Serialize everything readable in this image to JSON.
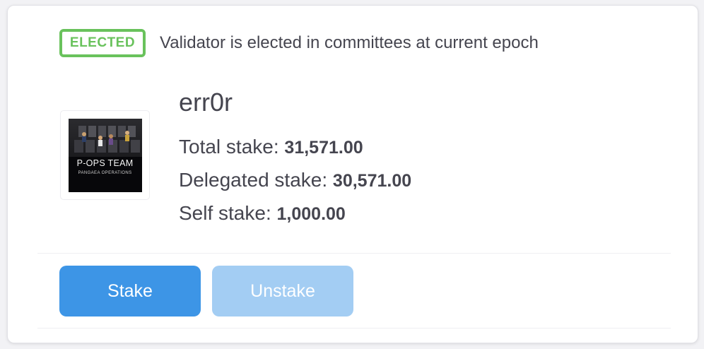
{
  "status": {
    "badge": "ELECTED",
    "description": "Validator is elected in committees at current epoch",
    "badge_color": "#69c25c"
  },
  "validator": {
    "name": "err0r",
    "logo": {
      "title": "P-OPS TEAM",
      "subtitle": "PANGAEA OPERATIONS"
    }
  },
  "stats": {
    "total_label": "Total stake:",
    "total_value": "31,571.00",
    "delegated_label": "Delegated stake:",
    "delegated_value": "30,571.00",
    "self_label": "Self stake:",
    "self_value": "1,000.00"
  },
  "actions": {
    "stake_label": "Stake",
    "unstake_label": "Unstake",
    "stake_color": "#3d95e6",
    "unstake_color": "#a3cdf3"
  }
}
